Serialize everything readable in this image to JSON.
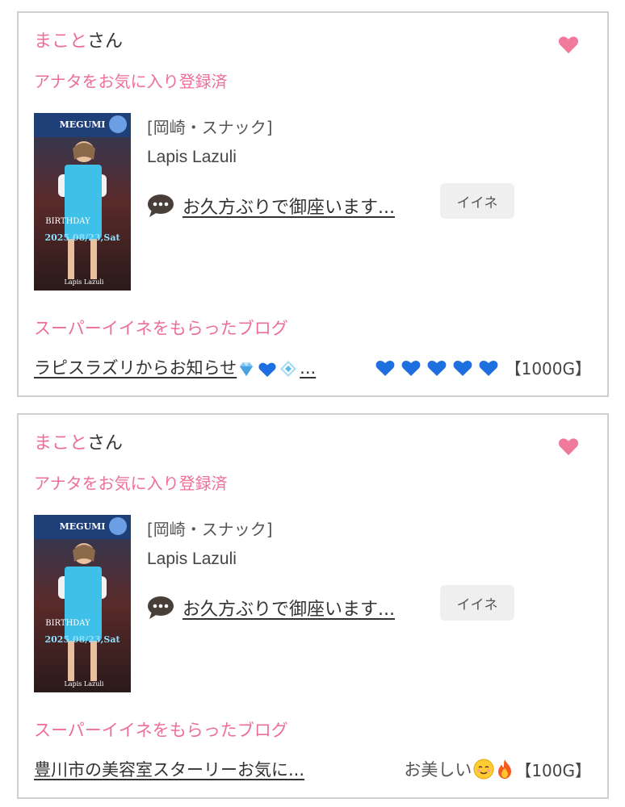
{
  "cards": [
    {
      "user_name": "まこと",
      "user_suffix": "さん",
      "fav_status": "アナタをお気に入り登録済",
      "thumbnail": {
        "top_text": "MEGUMI",
        "event_text": "BIRTHDAY",
        "date_text": "2025,08/23,Sat",
        "shop_text": "Lapis Lazuli"
      },
      "shop_category": "[岡崎・スナック]",
      "shop_name": "Lapis Lazuli",
      "message": "お久方ぶりで御座います...",
      "like_label": "イイネ",
      "super_label": "スーパーイイネをもらったブログ",
      "blog_title": "ラピスラズリからお知らせ",
      "blog_title_suffix": "...",
      "blog_comment": "",
      "blog_points": "【1000G】",
      "icons": [
        "heart-icon",
        "speech-bubble-icon",
        "gem-icon",
        "blue-heart-icon",
        "diamond-icon"
      ],
      "colors": {
        "accent": "#ee6f96",
        "blue_heart": "#1e6fe0"
      }
    },
    {
      "user_name": "まこと",
      "user_suffix": "さん",
      "fav_status": "アナタをお気に入り登録済",
      "thumbnail": {
        "top_text": "MEGUMI",
        "event_text": "BIRTHDAY",
        "date_text": "2025,08/23,Sat",
        "shop_text": "Lapis Lazuli"
      },
      "shop_category": "[岡崎・スナック]",
      "shop_name": "Lapis Lazuli",
      "message": "お久方ぶりで御座います...",
      "like_label": "イイネ",
      "super_label": "スーパーイイネをもらったブログ",
      "blog_title": "豊川市の美容室スターリーお気に...",
      "blog_title_suffix": "",
      "blog_comment": "お美しい",
      "blog_points": "【100G】",
      "icons": [
        "heart-icon",
        "speech-bubble-icon",
        "smiling-face-icon",
        "fire-icon"
      ],
      "colors": {
        "accent": "#ee6f96"
      }
    }
  ]
}
